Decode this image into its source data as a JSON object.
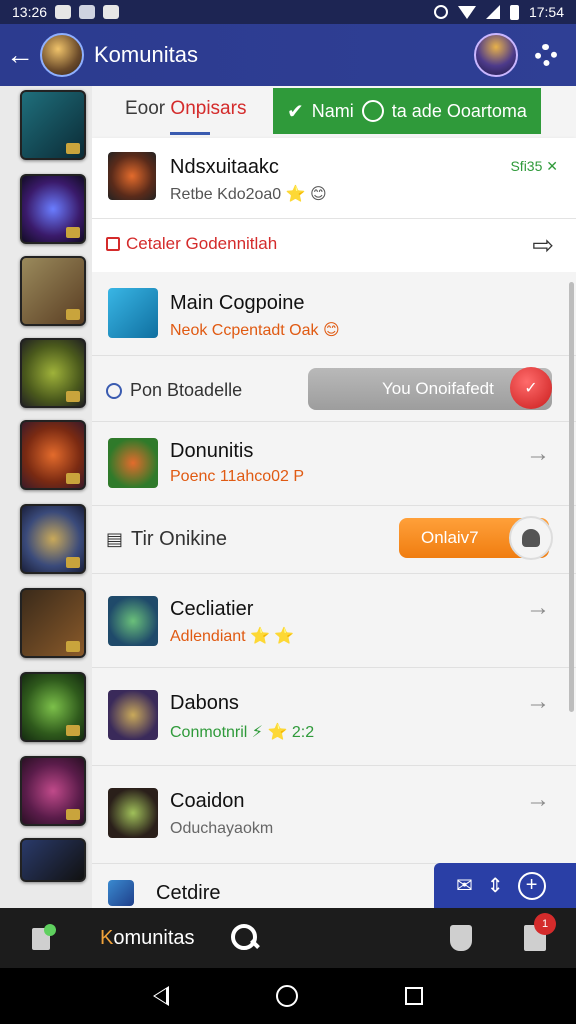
{
  "status_bar": {
    "time_left": "13:26",
    "time_right": "17:54"
  },
  "header": {
    "title": "Komunitas",
    "back_icon": "arrow-left-icon"
  },
  "tabs": {
    "left_prefix": "Eoor ",
    "left_red": "Onpisars",
    "green_prefix": "Nami ",
    "green_suffix": "ta ade Ooartoma"
  },
  "featured": {
    "title": "Ndsxuitaakc",
    "subtitle": "Retbe Kdo2oa0 ⭐ 😊",
    "badge": "Sfi35 ✕",
    "link": "Cetaler Godennitlah"
  },
  "rows": [
    {
      "kind": "item",
      "title": "Main Cogpoine",
      "subtitle": "Neok Ccpentadt Oak 😊",
      "subtitle_color": "#e05a12"
    },
    {
      "kind": "toggle",
      "label": "Pon Btoadelle",
      "pill_text": "You Onoifafedt"
    },
    {
      "kind": "item",
      "title": "Donunitis",
      "subtitle": "Poenc 11ahco02 P",
      "subtitle_color": "#e05a12"
    },
    {
      "kind": "toggle2",
      "label": "Tir Onikine",
      "pill_text": "Onlaiv7"
    },
    {
      "kind": "item",
      "title": "Cecliatier",
      "subtitle": "Adlendiant ⭐ ⭐",
      "subtitle_color": "#e05a12"
    },
    {
      "kind": "item",
      "title": "Dabons",
      "subtitle": "Conmotnril ⚡ ⭐ 2:2",
      "subtitle_color": "#2f9a3a"
    },
    {
      "kind": "item",
      "title": "Coaidon",
      "subtitle": "Oduchayaokm",
      "subtitle_color": "#666666"
    },
    {
      "kind": "item",
      "title": "Cetdire",
      "subtitle": "",
      "subtitle_color": "#666666"
    }
  ],
  "bottom_bar": {
    "label_prefix": "K",
    "label": "omunitas",
    "notif_count": "1"
  },
  "colors": {
    "app_bar": "#2c3b8f",
    "accent_green": "#2f9a3a",
    "accent_red": "#d42b2b",
    "accent_orange": "#f07d10"
  }
}
